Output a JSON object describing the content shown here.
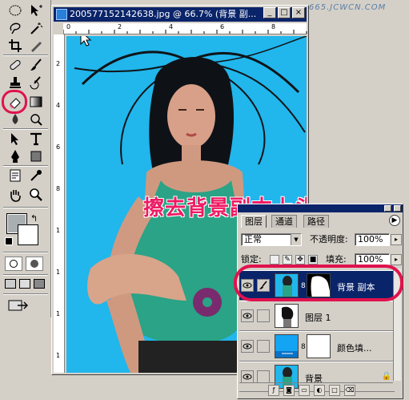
{
  "document": {
    "title": "20057715214263​8.jpg @ 66.7% (背景 副...",
    "ruler_top": [
      "0",
      "2",
      "4",
      "6",
      "8"
    ],
    "ruler_left": [
      "2",
      "4",
      "6",
      "8",
      "1",
      "1",
      "1",
      "1"
    ],
    "overlay_text": "擦去背景副本上头发的杂色"
  },
  "window_buttons": {
    "minimize": "_",
    "maximize": "□",
    "close": "×"
  },
  "watermark": "665.JCWCN.COM",
  "colors": {
    "canvas_bg": "#21b6ec",
    "accent_highlight": "#e0124e",
    "selection": "#0a246a",
    "overlay_text": "#ef1a63"
  },
  "tools": [
    "marquee-icon",
    "move-icon",
    "lasso-icon",
    "magic-wand-icon",
    "crop-icon",
    "slice-icon",
    "healing-brush-icon",
    "brush-icon",
    "clone-stamp-icon",
    "history-brush-icon",
    "eraser-icon",
    "gradient-icon",
    "blur-icon",
    "dodge-icon",
    "path-select-icon",
    "type-icon",
    "pen-icon",
    "shape-icon",
    "notes-icon",
    "eyedropper-icon",
    "hand-icon",
    "zoom-icon"
  ],
  "layers_panel": {
    "tabs": [
      "图层",
      "通道",
      "路径"
    ],
    "blend_mode": "正常",
    "opacity_label": "不透明度:",
    "opacity_value": "100%",
    "lock_label": "锁定:",
    "fill_label": "填充:",
    "fill_value": "100%",
    "layers": [
      {
        "name": "背景 副本",
        "selected": true
      },
      {
        "name": "图层 1",
        "selected": false
      },
      {
        "name": "颜色填...",
        "selected": false
      },
      {
        "name": "背景",
        "selected": false
      }
    ]
  }
}
